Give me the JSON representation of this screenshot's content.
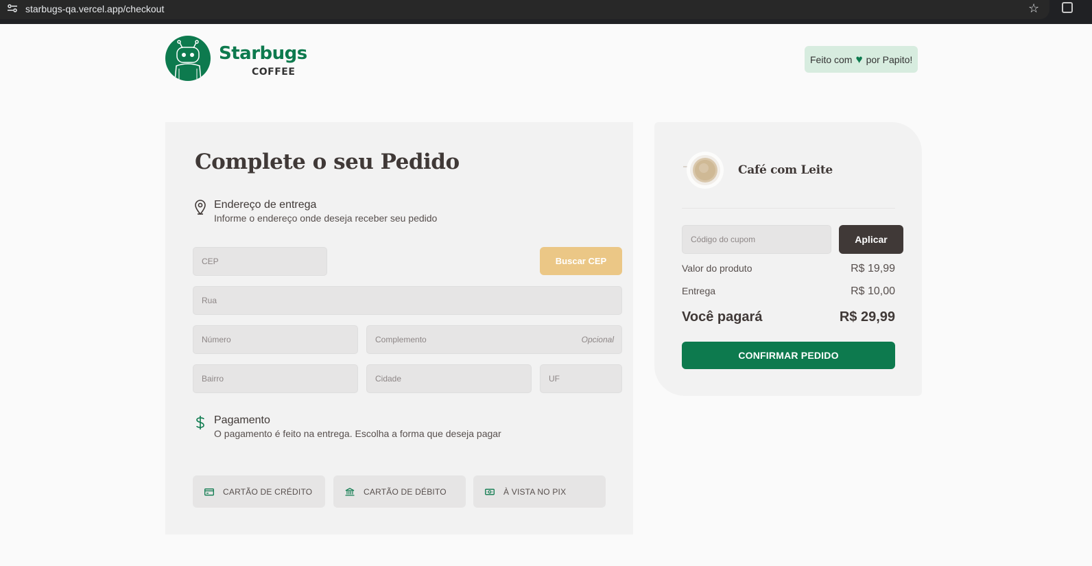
{
  "browser": {
    "url": "starbugs-qa.vercel.app/checkout",
    "site_info_icon": "tune-icon",
    "bookmark_icon": "star-icon",
    "extensions_icon": "extensions-icon"
  },
  "header": {
    "brand": "Starbugs",
    "brand_sub": "COFFEE",
    "made_by_prefix": "Feito com",
    "made_by_icon": "heart-icon",
    "made_by_suffix": "por Papito!"
  },
  "checkout": {
    "title": "Complete o seu Pedido",
    "address": {
      "icon": "map-pin-icon",
      "title": "Endereço de entrega",
      "subtitle": "Informe o endereço onde deseja receber seu pedido",
      "cep_placeholder": "CEP",
      "search_button": "Buscar CEP",
      "street_placeholder": "Rua",
      "number_placeholder": "Número",
      "complement_placeholder": "Complemento",
      "complement_hint": "Opcional",
      "district_placeholder": "Bairro",
      "city_placeholder": "Cidade",
      "state_placeholder": "UF"
    },
    "payment": {
      "icon": "dollar-icon",
      "title": "Pagamento",
      "subtitle": "O pagamento é feito na entrega. Escolha a forma que deseja pagar",
      "options": [
        {
          "label": "CARTÃO DE CRÉDITO",
          "icon": "credit-card-icon"
        },
        {
          "label": "CARTÃO DE DÉBITO",
          "icon": "bank-icon"
        },
        {
          "label": "À VISTA NO PIX",
          "icon": "money-icon"
        }
      ]
    }
  },
  "summary": {
    "product_name": "Café com Leite",
    "coupon_placeholder": "Código do cupom",
    "apply_button": "Aplicar",
    "product_value_label": "Valor do produto",
    "product_value": "R$ 19,99",
    "delivery_label": "Entrega",
    "delivery_value": "R$ 10,00",
    "total_label": "Você pagará",
    "total_value": "R$ 29,99",
    "confirm_button": "CONFIRMAR PEDIDO"
  },
  "colors": {
    "brand_green": "#0d7a4e",
    "dark_brown": "#403937",
    "yellow": "#ebc786",
    "panel_bg": "#f2f2f2"
  }
}
